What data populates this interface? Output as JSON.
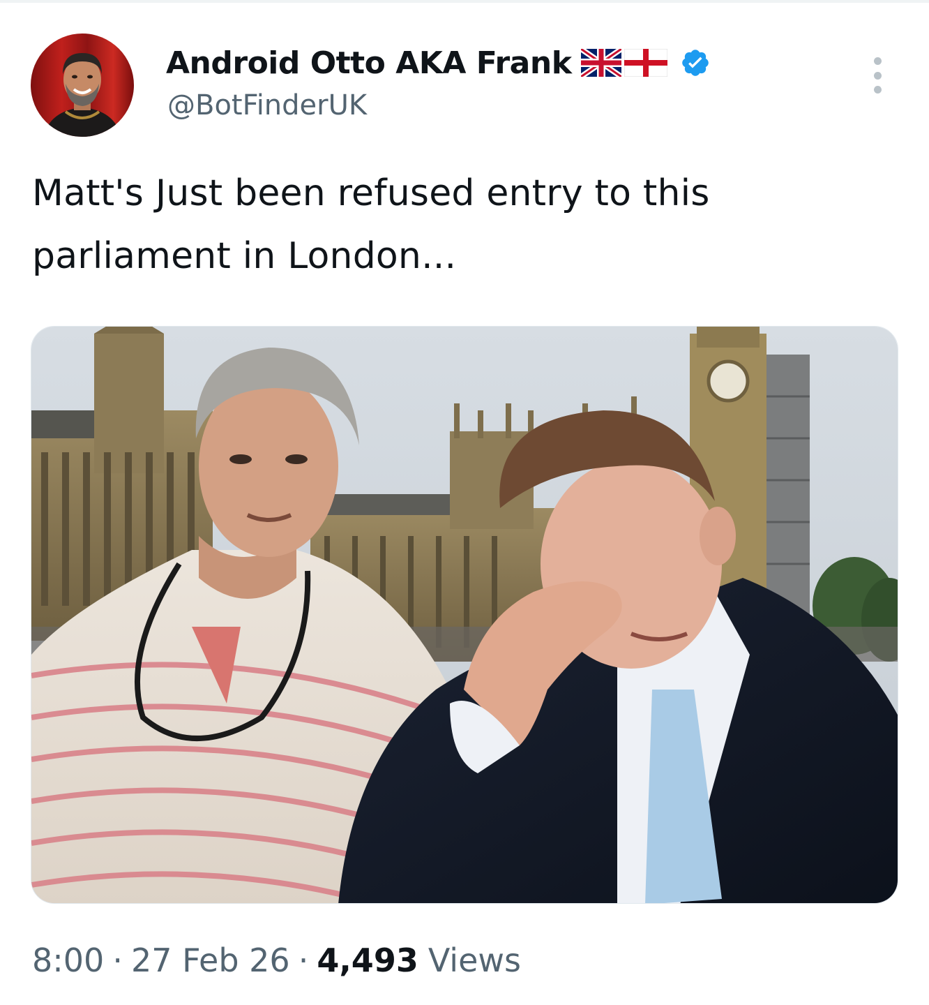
{
  "author": {
    "display_name": "Android Otto AKA Frank",
    "handle": "@BotFinderUK",
    "flags": [
      "union-jack-flag",
      "england-flag"
    ],
    "verified": true,
    "verified_color": "#1d9bf0"
  },
  "tweet": {
    "text": "Matt's Just been refused entry to this parliament in London..."
  },
  "media": {
    "type": "photo"
  },
  "meta": {
    "time": "8:00",
    "separator": "·",
    "date": "27 Feb 26",
    "views_count": "4,493",
    "views_label": "Views"
  },
  "colors": {
    "text_primary": "#0f1419",
    "text_secondary": "#536471",
    "accent": "#1d9bf0"
  }
}
